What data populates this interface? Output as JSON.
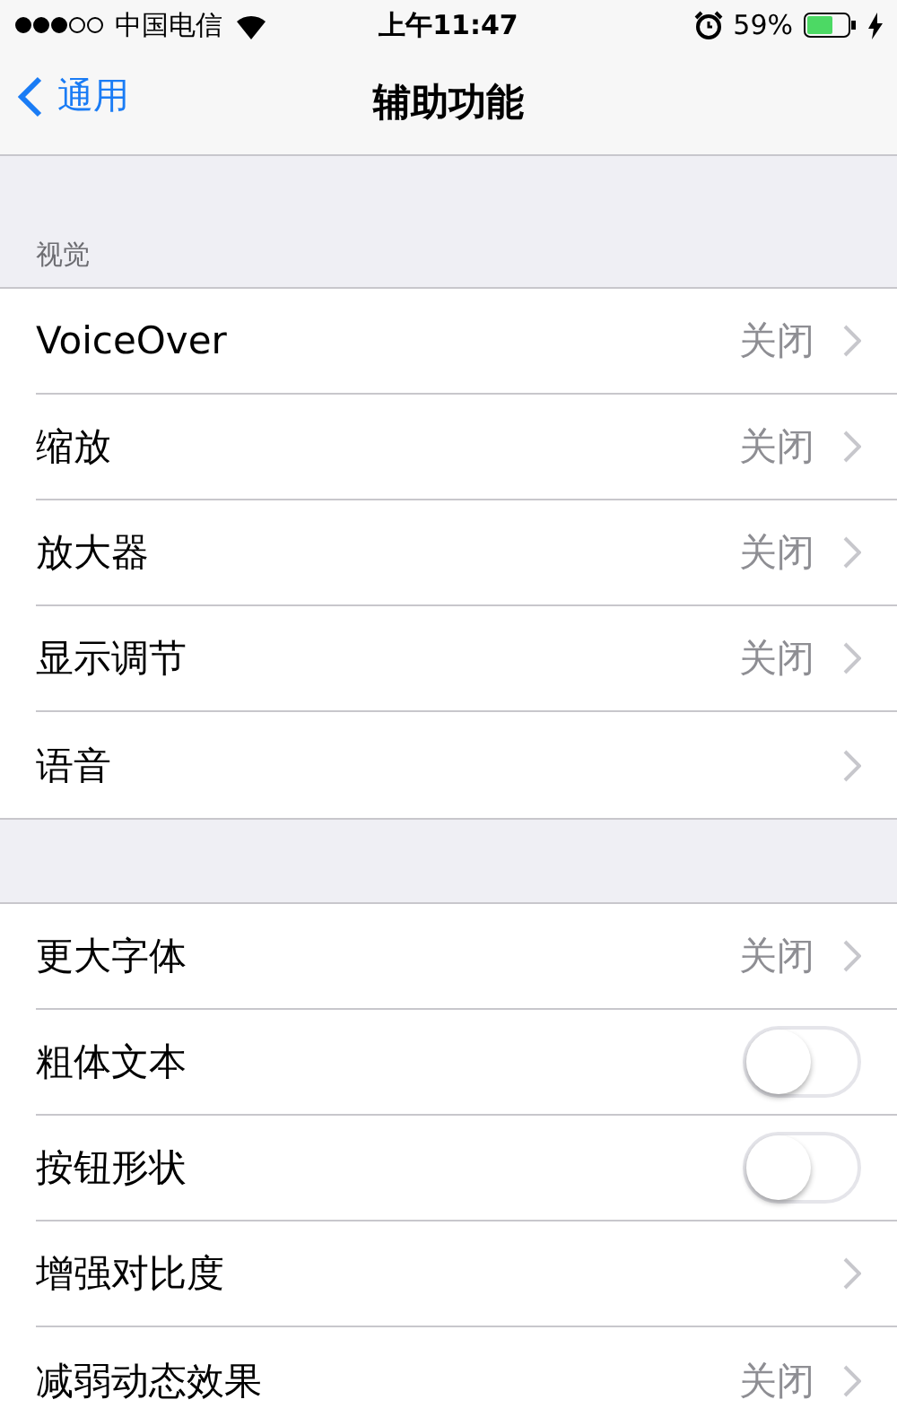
{
  "status_bar": {
    "carrier": "中国电信",
    "time": "上午11:47",
    "battery": "59%"
  },
  "nav": {
    "back": "通用",
    "title": "辅助功能"
  },
  "sections": [
    {
      "header": "视觉",
      "rows": [
        {
          "kind": "detail",
          "label": "VoiceOver",
          "value": "关闭"
        },
        {
          "kind": "detail",
          "label": "缩放",
          "value": "关闭"
        },
        {
          "kind": "detail",
          "label": "放大器",
          "value": "关闭"
        },
        {
          "kind": "detail",
          "label": "显示调节",
          "value": "关闭"
        },
        {
          "kind": "link",
          "label": "语音"
        }
      ]
    },
    {
      "rows": [
        {
          "kind": "detail",
          "label": "更大字体",
          "value": "关闭"
        },
        {
          "kind": "toggle",
          "label": "粗体文本",
          "on": false
        },
        {
          "kind": "toggle",
          "label": "按钮形状",
          "on": false
        },
        {
          "kind": "link",
          "label": "增强对比度"
        },
        {
          "kind": "detail",
          "label": "减弱动态效果",
          "value": "关闭"
        }
      ]
    }
  ]
}
